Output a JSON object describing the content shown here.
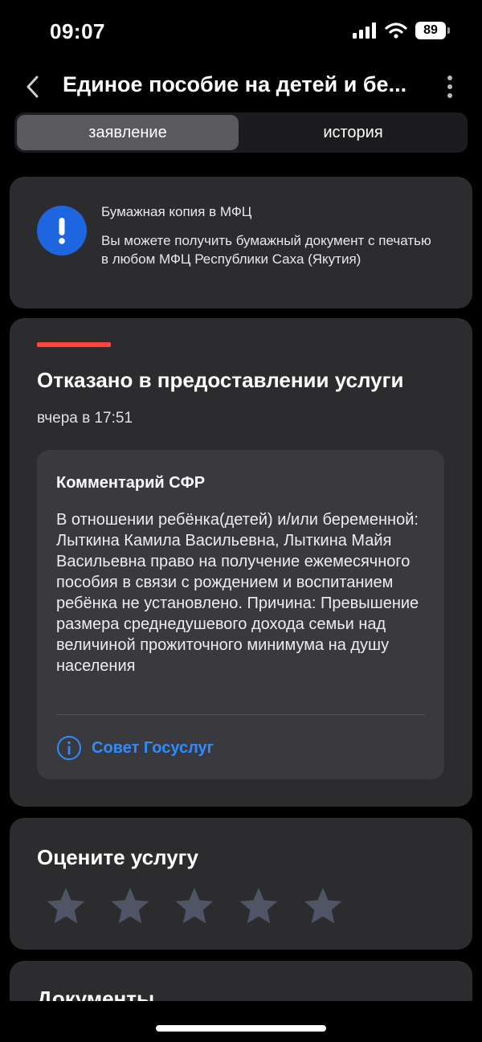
{
  "status_bar": {
    "time": "09:07",
    "battery": "89"
  },
  "nav": {
    "title": "Единое пособие на детей и бе..."
  },
  "tabs": [
    {
      "label": "заявление",
      "active": true
    },
    {
      "label": "история",
      "active": false
    }
  ],
  "info": {
    "title": "Бумажная копия в МФЦ",
    "text": "Вы можете получить бумажный документ с печатью в любом МФЦ Республики Саха (Якутия)"
  },
  "status": {
    "title": "Отказано в предоставлении услуги",
    "date": "вчера в 17:51",
    "color": "#ff453a"
  },
  "comment": {
    "title": "Комментарий СФР",
    "text": "В отношении ребёнка(детей) и/или беременной: Лыткина Камила Васильевна, Лыткина Майя Васильевна право на получение ежемесячного пособия в связи с рождением и воспитанием ребёнка не установлено. Причина: Превышение размера среднедушевого дохода семьи над величиной прожиточного минимума на душу населения",
    "advice_label": "Совет Госуслуг"
  },
  "rating": {
    "title": "Оцените услугу",
    "max": 5,
    "value": 0
  },
  "documents": {
    "title": "Документы"
  },
  "colors": {
    "accent": "#2f8cff",
    "alert": "#1e66e0",
    "card": "#2c2c2e",
    "inner_card": "#3a3a3e"
  },
  "icons": [
    "signal-icon",
    "wifi-icon",
    "battery-icon",
    "chevron-left-icon",
    "more-vertical-icon",
    "exclamation-icon",
    "info-circle-icon",
    "star-icon"
  ]
}
